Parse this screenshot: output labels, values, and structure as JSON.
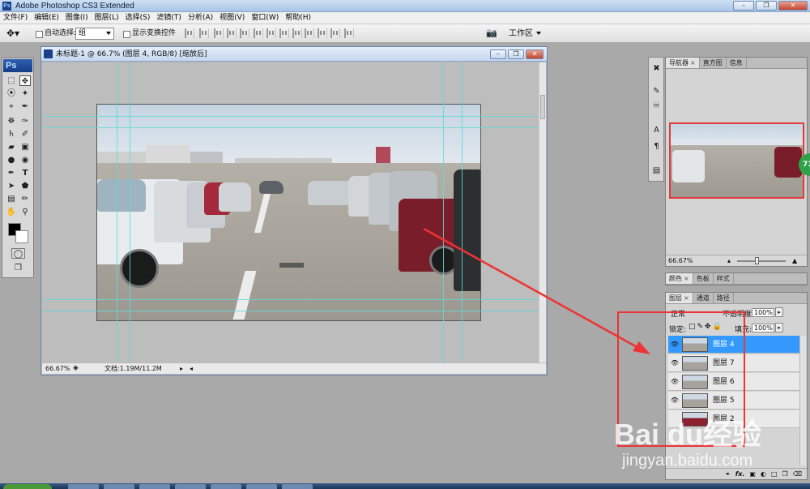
{
  "window": {
    "title": "Adobe Photoshop CS3 Extended",
    "app_icon": "Ps",
    "controls": [
      "minimize-icon",
      "restore-icon",
      "close-icon"
    ]
  },
  "menu": [
    "文件(F)",
    "编辑(E)",
    "图像(I)",
    "图层(L)",
    "选择(S)",
    "滤镜(T)",
    "分析(A)",
    "视图(V)",
    "窗口(W)",
    "帮助(H)"
  ],
  "options_bar": {
    "tool_icon": "move-tool-icon",
    "auto_select_label": "自动选择:",
    "auto_select_value": "组",
    "show_transform_label": "显示变换控件",
    "workspace_label": "工作区"
  },
  "toolbox": {
    "logo": "Ps",
    "tools": [
      "rect-marquee-icon",
      "move-icon",
      "lasso-icon",
      "magic-wand-icon",
      "crop-icon",
      "slice-icon",
      "healing-icon",
      "brush-icon",
      "stamp-icon",
      "history-brush-icon",
      "eraser-icon",
      "gradient-icon",
      "blur-icon",
      "dodge-icon",
      "pen-icon",
      "type-icon",
      "path-select-icon",
      "shape-icon",
      "notes-icon",
      "eyedropper-icon",
      "hand-icon",
      "zoom-icon"
    ],
    "foreground_color": "#000000",
    "background_color": "#ffffff"
  },
  "document": {
    "title": "未标题-1 @ 66.7% (图层 4, RGB/8) [缩放后]",
    "zoom": "66.67%",
    "doc_info": "文档:1.19M/11.2M"
  },
  "navigator": {
    "tabs": [
      {
        "label": "导航器",
        "active": true
      },
      {
        "label": "直方图",
        "active": false
      },
      {
        "label": "信息",
        "active": false
      }
    ],
    "zoom": "66.67%"
  },
  "color_panel": {
    "tabs": [
      {
        "label": "颜色",
        "active": true
      },
      {
        "label": "色板",
        "active": false
      },
      {
        "label": "样式",
        "active": false
      }
    ]
  },
  "layers_panel": {
    "tabs": [
      {
        "label": "图层",
        "active": true
      },
      {
        "label": "通道",
        "active": false
      },
      {
        "label": "路径",
        "active": false
      }
    ],
    "blend_mode": "正常",
    "opacity_label": "不透明度:",
    "opacity_value": "100%",
    "lock_label": "锁定:",
    "fill_label": "填充:",
    "fill_value": "100%",
    "layers": [
      {
        "name": "图层 4",
        "visible": true,
        "selected": true
      },
      {
        "name": "图层 7",
        "visible": true,
        "selected": false
      },
      {
        "name": "图层 6",
        "visible": true,
        "selected": false
      },
      {
        "name": "图层 5",
        "visible": true,
        "selected": false
      },
      {
        "name": "图层 2",
        "visible": false,
        "selected": false
      }
    ],
    "footer_icons": [
      "link-icon",
      "fx-icon",
      "mask-icon",
      "adjustment-icon",
      "group-icon",
      "new-layer-icon",
      "trash-icon"
    ]
  },
  "badge": "71",
  "watermark": {
    "top": "Bai du经验",
    "bottom": "jingyan.baidu.com"
  },
  "annotation_color": "#ee3333"
}
